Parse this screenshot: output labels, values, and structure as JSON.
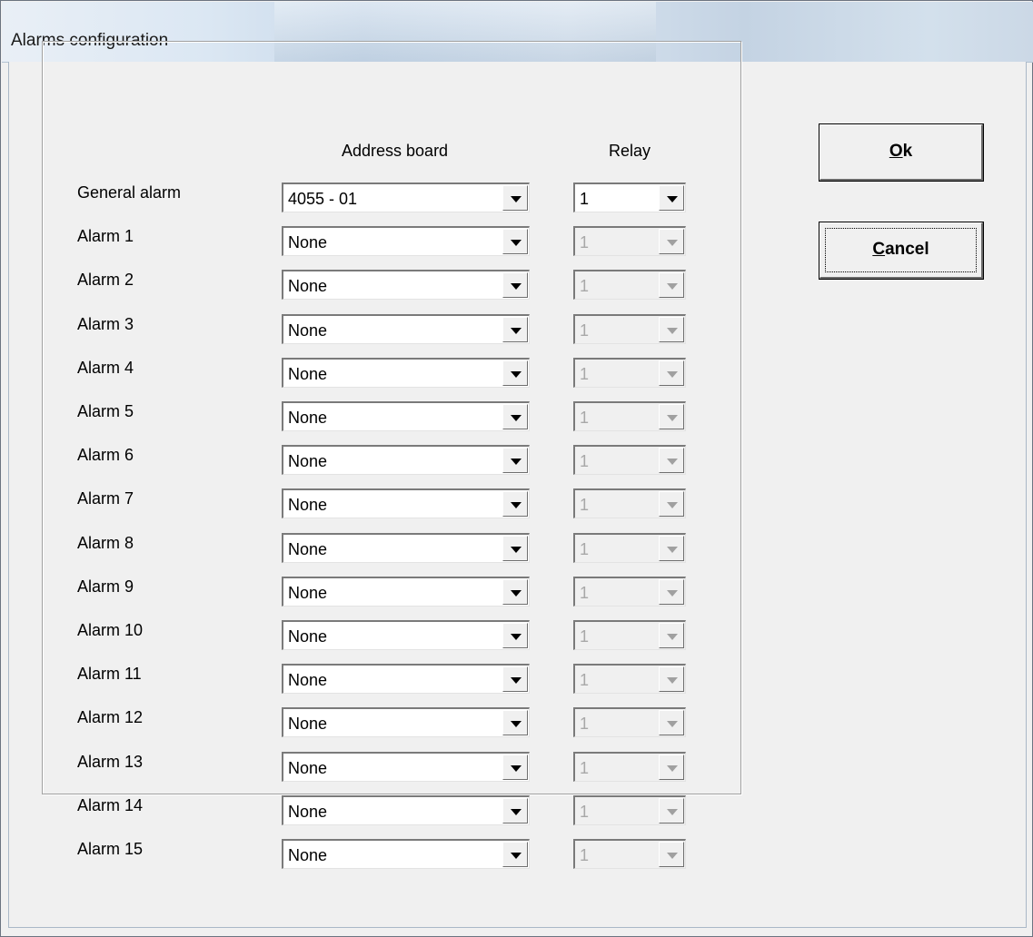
{
  "window": {
    "title": "Alarms configuration"
  },
  "headers": {
    "address_board": "Address board",
    "relay": "Relay"
  },
  "rows": [
    {
      "label": "General alarm",
      "board": "4055 - 01",
      "relay": "1",
      "relay_enabled": true
    },
    {
      "label": "Alarm 1",
      "board": "None",
      "relay": "1",
      "relay_enabled": false
    },
    {
      "label": "Alarm 2",
      "board": "None",
      "relay": "1",
      "relay_enabled": false
    },
    {
      "label": "Alarm 3",
      "board": "None",
      "relay": "1",
      "relay_enabled": false
    },
    {
      "label": "Alarm 4",
      "board": "None",
      "relay": "1",
      "relay_enabled": false
    },
    {
      "label": "Alarm 5",
      "board": "None",
      "relay": "1",
      "relay_enabled": false
    },
    {
      "label": "Alarm 6",
      "board": "None",
      "relay": "1",
      "relay_enabled": false
    },
    {
      "label": "Alarm 7",
      "board": "None",
      "relay": "1",
      "relay_enabled": false
    },
    {
      "label": "Alarm 8",
      "board": "None",
      "relay": "1",
      "relay_enabled": false
    },
    {
      "label": "Alarm 9",
      "board": "None",
      "relay": "1",
      "relay_enabled": false
    },
    {
      "label": "Alarm 10",
      "board": "None",
      "relay": "1",
      "relay_enabled": false
    },
    {
      "label": "Alarm 11",
      "board": "None",
      "relay": "1",
      "relay_enabled": false
    },
    {
      "label": "Alarm 12",
      "board": "None",
      "relay": "1",
      "relay_enabled": false
    },
    {
      "label": "Alarm 13",
      "board": "None",
      "relay": "1",
      "relay_enabled": false
    },
    {
      "label": "Alarm 14",
      "board": "None",
      "relay": "1",
      "relay_enabled": false
    },
    {
      "label": "Alarm 15",
      "board": "None",
      "relay": "1",
      "relay_enabled": false
    }
  ],
  "buttons": {
    "ok": {
      "label": "Ok",
      "mnemonic": "O",
      "rest": "k"
    },
    "cancel": {
      "label": "Cancel",
      "mnemonic": "C",
      "rest": "ancel"
    }
  },
  "icons": {
    "dropdown": "chevron-down-icon"
  }
}
